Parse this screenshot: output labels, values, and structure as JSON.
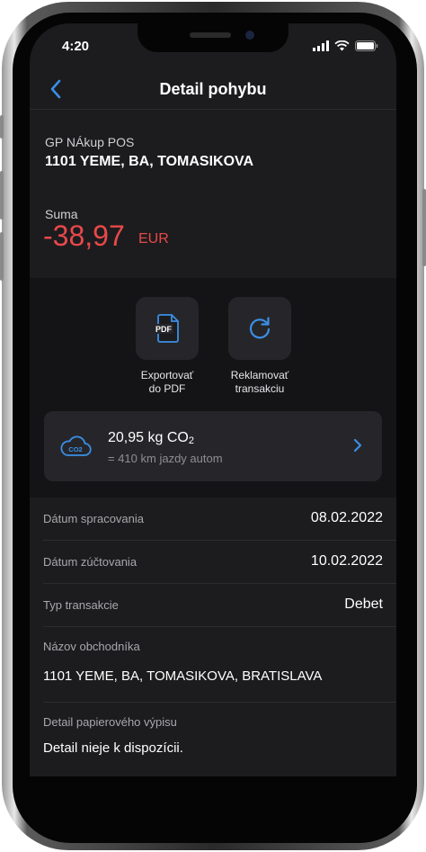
{
  "status_bar": {
    "time": "4:20"
  },
  "nav": {
    "title": "Detail pohybu"
  },
  "transaction": {
    "type_label": "GP NÁkup POS",
    "merchant": "1101 YEME, BA, TOMASIKOVA",
    "amount_label": "Suma",
    "amount": "-38,97",
    "currency": "EUR"
  },
  "actions": [
    {
      "label_line1": "Exportovať",
      "label_line2": "do PDF",
      "icon": "pdf-icon",
      "icon_text": "PDF"
    },
    {
      "label_line1": "Reklamovať",
      "label_line2": "transakciu",
      "icon": "refresh-icon"
    }
  ],
  "co2": {
    "value": "20,95 kg CO",
    "value_sub": "2",
    "equivalent": "= 410 km jazdy autom",
    "icon": "cloud-co2-icon",
    "icon_text": "CO2"
  },
  "details": [
    {
      "label": "Dátum spracovania",
      "value": "08.02.2022"
    },
    {
      "label": "Dátum zúčtovania",
      "value": "10.02.2022"
    },
    {
      "label": "Typ transakcie",
      "value": "Debet"
    },
    {
      "label": "Názov obchodníka",
      "value": "1101 YEME, BA, TOMASIKOVA, BRATISLAVA"
    },
    {
      "label": "Detail papierového výpisu",
      "value": "Detail nieje k dispozícii."
    }
  ],
  "colors": {
    "accent": "#3a8fe6",
    "negative_amount": "#e8484a",
    "background": "#1c1c1e",
    "card": "#26262a"
  }
}
